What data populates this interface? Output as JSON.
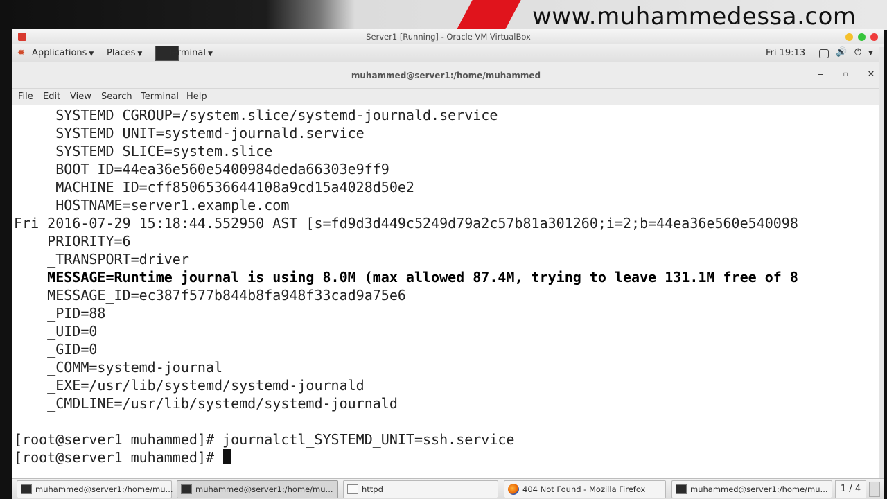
{
  "watermark": "www.muhammedessa.com",
  "vbox": {
    "title": "Server1 [Running] - Oracle VM VirtualBox"
  },
  "topbar": {
    "applications": "Applications",
    "places": "Places",
    "terminal": "Terminal",
    "clock": "Fri 19:13"
  },
  "terminal": {
    "title": "muhammed@server1:/home/muhammed",
    "menu": [
      "File",
      "Edit",
      "View",
      "Search",
      "Terminal",
      "Help"
    ],
    "lines": [
      "    _SYSTEMD_CGROUP=/system.slice/systemd-journald.service",
      "    _SYSTEMD_UNIT=systemd-journald.service",
      "    _SYSTEMD_SLICE=system.slice",
      "    _BOOT_ID=44ea36e560e5400984deda66303e9ff9",
      "    _MACHINE_ID=cff8506536644108a9cd15a4028d50e2",
      "    _HOSTNAME=server1.example.com",
      "Fri 2016-07-29 15:18:44.552950 AST [s=fd9d3d449c5249d79a2c57b81a301260;i=2;b=44ea36e560e540098",
      "    PRIORITY=6",
      "    _TRANSPORT=driver",
      "    MESSAGE=Runtime journal is using 8.0M (max allowed 87.4M, trying to leave 131.1M free of 8",
      "    MESSAGE_ID=ec387f577b844b8fa948f33cad9a75e6",
      "    _PID=88",
      "    _UID=0",
      "    _GID=0",
      "    _COMM=systemd-journal",
      "    _EXE=/usr/lib/systemd/systemd-journald",
      "    _CMDLINE=/usr/lib/systemd/systemd-journald",
      "",
      "[root@server1 muhammed]# journalctl_SYSTEMD_UNIT=ssh.service",
      "[root@server1 muhammed]# "
    ]
  },
  "taskbar": {
    "items": [
      "muhammed@server1:/home/mu...",
      "muhammed@server1:/home/mu...",
      "httpd",
      "404 Not Found - Mozilla Firefox",
      "muhammed@server1:/home/mu..."
    ],
    "workspace": "1 / 4"
  }
}
